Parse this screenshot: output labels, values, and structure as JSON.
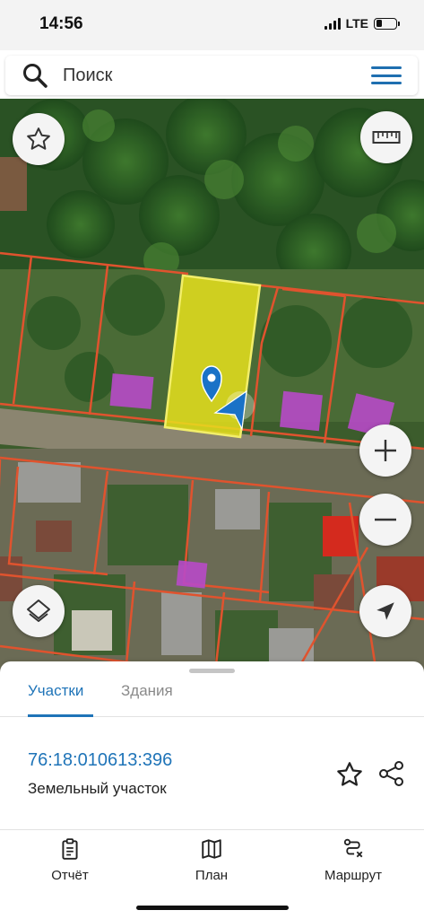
{
  "status_bar": {
    "time": "14:56",
    "network": "LTE",
    "signal_bars": 4,
    "battery_level": 0.3
  },
  "search": {
    "placeholder": "Поиск",
    "icon": "search-icon",
    "menu_icon": "hamburger-menu-icon"
  },
  "map": {
    "buttons": [
      "favorite-star-icon",
      "ruler-icon",
      "zoom-in-icon",
      "zoom-out-icon",
      "layers-icon",
      "locate-me-icon"
    ],
    "colors": {
      "parcel_border": "#e0532e",
      "selected_parcel": "#e6e01c",
      "building_overlay": "#b84ac9",
      "location_arrow": "#1a72c7"
    }
  },
  "sheet": {
    "tabs": [
      {
        "label": "Участки",
        "active": true
      },
      {
        "label": "Здания",
        "active": false
      }
    ],
    "parcel": {
      "cadastral_number": "76:18:010613:396",
      "type": "Земельный участок"
    }
  },
  "bottom_nav": [
    {
      "label": "Отчёт",
      "icon": "report-clipboard-icon"
    },
    {
      "label": "План",
      "icon": "map-plan-icon"
    },
    {
      "label": "Маршрут",
      "icon": "route-icon"
    }
  ],
  "colors": {
    "accent": "#1f74b8"
  }
}
